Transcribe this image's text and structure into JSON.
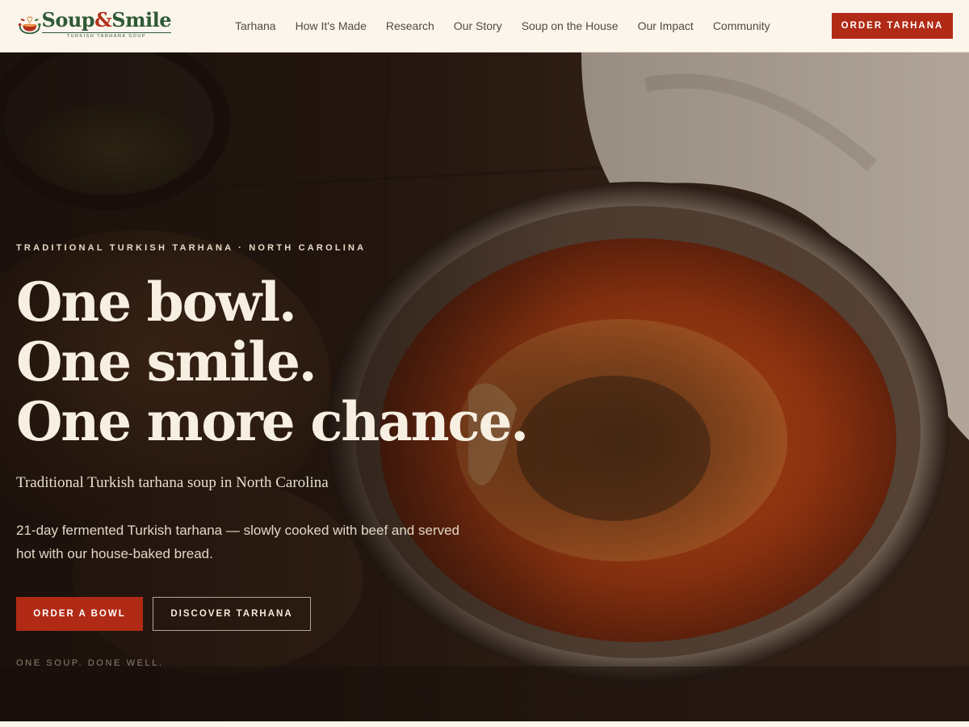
{
  "brand": {
    "name_part1": "Soup",
    "name_amp": "&",
    "name_part2": "Smile",
    "tagline": "TURKISH TARHANA SOUP"
  },
  "nav": {
    "items": [
      {
        "label": "Tarhana"
      },
      {
        "label": "How It's Made"
      },
      {
        "label": "Research"
      },
      {
        "label": "Our Story"
      },
      {
        "label": "Soup on the House"
      },
      {
        "label": "Our Impact"
      },
      {
        "label": "Community"
      }
    ],
    "cta_label": "ORDER TARHANA"
  },
  "hero": {
    "eyebrow": "TRADITIONAL TURKISH TARHANA · NORTH CAROLINA",
    "headline": [
      "One bowl.",
      "One smile.",
      "One more chance."
    ],
    "subhead": "Traditional Turkish tarhana soup in North Carolina",
    "body": "21-day fermented Turkish tarhana — slowly cooked with beef and served hot with our house-baked bread.",
    "primary_button": "ORDER A BOWL",
    "secondary_button": "DISCOVER TARHANA",
    "tagline": "ONE SOUP. DONE WELL."
  },
  "colors": {
    "accent": "#b12a15",
    "brand_green": "#2f5a35",
    "header_bg": "#fbf5ec",
    "hero_text": "#f7efe2"
  },
  "icons": {
    "logo": "soup-bowl-heart-logo-icon"
  }
}
